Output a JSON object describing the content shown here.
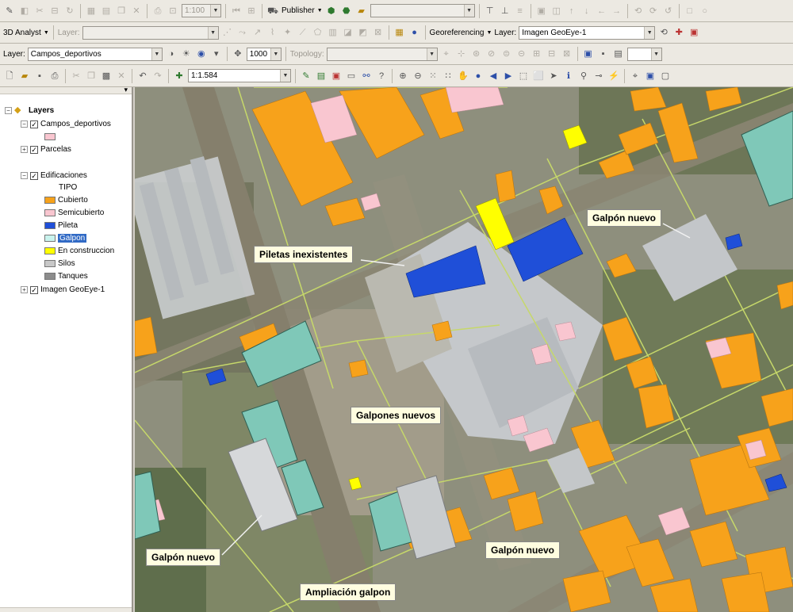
{
  "toolbar1": {
    "scale_value": "1:100",
    "publish_label": "Publisher",
    "publish_caret": "▼"
  },
  "toolbar2": {
    "analyst_label": "3D Analyst",
    "layer_label": "Layer:",
    "georef_label": "Georeferencing",
    "georef_layer_label": "Layer:",
    "georef_layer_value": "Imagen GeoEye-1"
  },
  "toolbar3": {
    "layer_label": "Layer:",
    "layer_value": "Campos_deportivos",
    "scale_input": "1000",
    "topology_label": "Topology:"
  },
  "toolbar4": {
    "map_scale": "1:1.584"
  },
  "toc": {
    "title": "Layers",
    "layers": [
      {
        "label": "Campos_deportivos",
        "checked": "✓"
      },
      {
        "label": "Parcelas",
        "checked": "✓"
      },
      {
        "label": "Edificaciones",
        "checked": "✓"
      },
      {
        "label": "Imagen GeoEye-1",
        "checked": "✓"
      }
    ],
    "tipo_label": "TIPO",
    "legend": [
      {
        "label": "Cubierto",
        "color": "#f7a21b"
      },
      {
        "label": "Semicubierto",
        "color": "#f9c6d0"
      },
      {
        "label": "Pileta",
        "color": "#1f4fd8"
      },
      {
        "label": "Galpon",
        "color": "#c9f3ee"
      },
      {
        "label": "En construccion",
        "color": "#ffff00"
      },
      {
        "label": "Silos",
        "color": "#c8c8c8"
      },
      {
        "label": "Tanques",
        "color": "#8c8c8c"
      }
    ]
  },
  "map": {
    "callouts": [
      {
        "text": "Piletas inexistentes"
      },
      {
        "text": "Galpón nuevo"
      },
      {
        "text": "Galpones nuevos"
      },
      {
        "text": "Galpón nuevo"
      },
      {
        "text": "Galpón nuevo"
      },
      {
        "text": "Ampliación galpon"
      }
    ]
  },
  "colors": {
    "cubierto": "#f7a21b",
    "semicubierto": "#f9c6d0",
    "pileta": "#1f4fd8",
    "galpon": "#7fc8b8",
    "en_construccion": "#ffff00",
    "parcel_line": "#c6d86a"
  }
}
